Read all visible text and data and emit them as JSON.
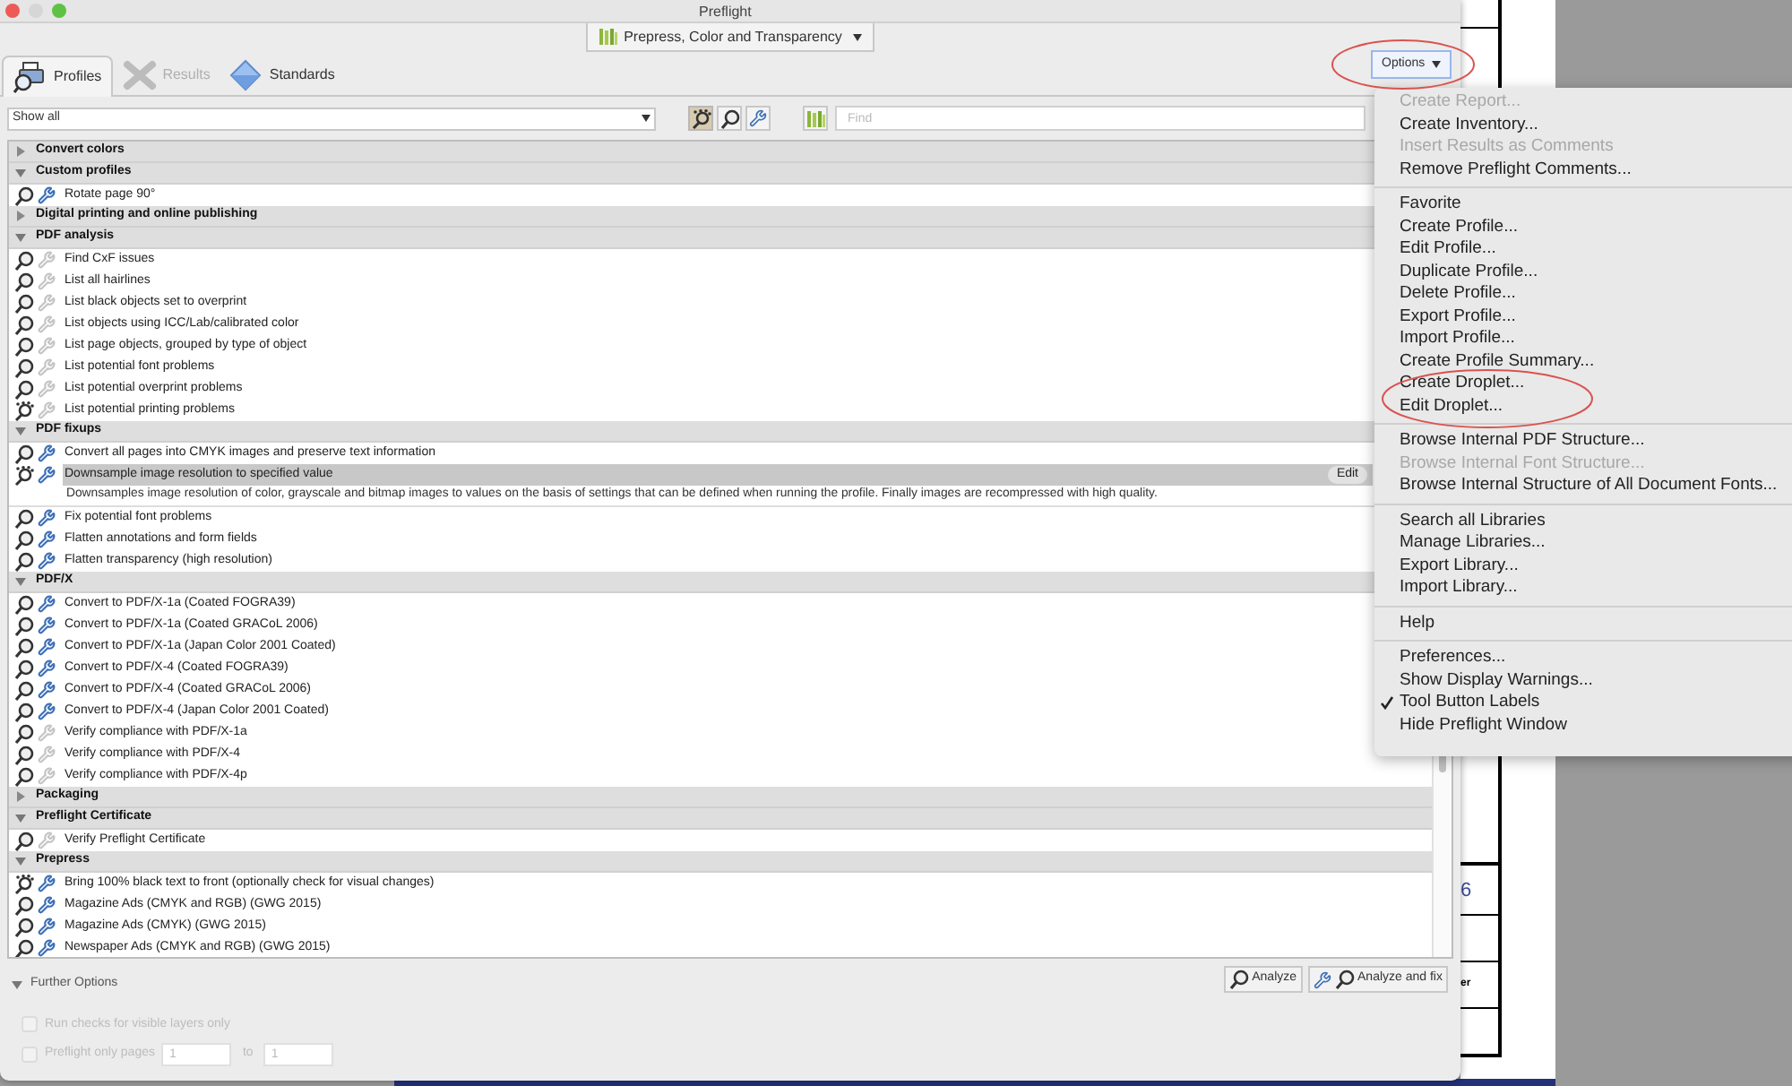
{
  "window": {
    "title": "Preflight"
  },
  "library_dropdown": {
    "value": "Prepress, Color and Transparency"
  },
  "tabs": [
    {
      "label": "Profiles",
      "selected": true,
      "disabled": false,
      "kind": "profiles"
    },
    {
      "label": "Results",
      "selected": false,
      "disabled": true,
      "kind": "results"
    },
    {
      "label": "Standards",
      "selected": false,
      "disabled": false,
      "kind": "standards"
    }
  ],
  "options_button": {
    "label": "Options"
  },
  "filter": {
    "value": "Show all"
  },
  "find": {
    "placeholder": "Find"
  },
  "tree": [
    {
      "kind": "category",
      "label": "Convert colors",
      "expanded": false
    },
    {
      "kind": "category",
      "label": "Custom profiles",
      "expanded": true
    },
    {
      "kind": "profile",
      "label": "Rotate page 90°",
      "droplet": false,
      "fixup": true,
      "selected": false
    },
    {
      "kind": "category",
      "label": "Digital printing and online publishing",
      "expanded": false
    },
    {
      "kind": "category",
      "label": "PDF analysis",
      "expanded": true
    },
    {
      "kind": "profile",
      "label": "Find CxF issues",
      "droplet": false,
      "fixup": false,
      "selected": false
    },
    {
      "kind": "profile",
      "label": "List all hairlines",
      "droplet": false,
      "fixup": false,
      "selected": false
    },
    {
      "kind": "profile",
      "label": "List black objects set to overprint",
      "droplet": false,
      "fixup": false,
      "selected": false
    },
    {
      "kind": "profile",
      "label": "List objects using ICC/Lab/calibrated color",
      "droplet": false,
      "fixup": false,
      "selected": false
    },
    {
      "kind": "profile",
      "label": "List page objects, grouped by type of object",
      "droplet": false,
      "fixup": false,
      "selected": false
    },
    {
      "kind": "profile",
      "label": "List potential font problems",
      "droplet": false,
      "fixup": false,
      "selected": false
    },
    {
      "kind": "profile",
      "label": "List potential overprint problems",
      "droplet": false,
      "fixup": false,
      "selected": false
    },
    {
      "kind": "profile",
      "label": "List potential printing problems",
      "droplet": true,
      "fixup": false,
      "selected": false
    },
    {
      "kind": "category",
      "label": "PDF fixups",
      "expanded": true
    },
    {
      "kind": "profile",
      "label": "Convert all pages into CMYK images and preserve text information",
      "droplet": false,
      "fixup": true,
      "selected": false
    },
    {
      "kind": "profile",
      "label": "Downsample image resolution to specified value",
      "droplet": true,
      "fixup": true,
      "selected": true,
      "edit_label": "Edit",
      "description": "Downsamples image resolution of color, grayscale and bitmap images to values on the basis of settings that can be defined when running the profile. Finally images are recompressed with high quality."
    },
    {
      "kind": "profile",
      "label": "Fix potential font problems",
      "droplet": false,
      "fixup": true,
      "selected": false
    },
    {
      "kind": "profile",
      "label": "Flatten annotations and form fields",
      "droplet": false,
      "fixup": true,
      "selected": false
    },
    {
      "kind": "profile",
      "label": "Flatten transparency (high resolution)",
      "droplet": false,
      "fixup": true,
      "selected": false
    },
    {
      "kind": "category",
      "label": "PDF/X",
      "expanded": true
    },
    {
      "kind": "profile",
      "label": "Convert to PDF/X-1a (Coated FOGRA39)",
      "droplet": false,
      "fixup": true,
      "selected": false
    },
    {
      "kind": "profile",
      "label": "Convert to PDF/X-1a (Coated GRACoL 2006)",
      "droplet": false,
      "fixup": true,
      "selected": false
    },
    {
      "kind": "profile",
      "label": "Convert to PDF/X-1a (Japan Color 2001 Coated)",
      "droplet": false,
      "fixup": true,
      "selected": false
    },
    {
      "kind": "profile",
      "label": "Convert to PDF/X-4 (Coated FOGRA39)",
      "droplet": false,
      "fixup": true,
      "selected": false
    },
    {
      "kind": "profile",
      "label": "Convert to PDF/X-4 (Coated GRACoL 2006)",
      "droplet": false,
      "fixup": true,
      "selected": false
    },
    {
      "kind": "profile",
      "label": "Convert to PDF/X-4 (Japan Color 2001 Coated)",
      "droplet": false,
      "fixup": true,
      "selected": false
    },
    {
      "kind": "profile",
      "label": "Verify compliance with PDF/X-1a",
      "droplet": false,
      "fixup": false,
      "selected": false
    },
    {
      "kind": "profile",
      "label": "Verify compliance with PDF/X-4",
      "droplet": false,
      "fixup": false,
      "selected": false
    },
    {
      "kind": "profile",
      "label": "Verify compliance with PDF/X-4p",
      "droplet": false,
      "fixup": false,
      "selected": false
    },
    {
      "kind": "category",
      "label": "Packaging",
      "expanded": false
    },
    {
      "kind": "category",
      "label": "Preflight Certificate",
      "expanded": true
    },
    {
      "kind": "profile",
      "label": "Verify Preflight Certificate",
      "droplet": false,
      "fixup": false,
      "selected": false
    },
    {
      "kind": "category",
      "label": "Prepress",
      "expanded": true
    },
    {
      "kind": "profile",
      "label": "Bring 100% black text to front (optionally check for visual changes)",
      "droplet": true,
      "fixup": true,
      "selected": false
    },
    {
      "kind": "profile",
      "label": "Magazine Ads (CMYK and RGB) (GWG 2015)",
      "droplet": false,
      "fixup": true,
      "selected": false
    },
    {
      "kind": "profile",
      "label": "Magazine Ads (CMYK) (GWG 2015)",
      "droplet": false,
      "fixup": true,
      "selected": false
    },
    {
      "kind": "profile",
      "label": "Newspaper Ads (CMYK and RGB) (GWG 2015)",
      "droplet": false,
      "fixup": true,
      "selected": false
    }
  ],
  "further_options": {
    "label": "Further Options",
    "expanded": true,
    "visible_layers": {
      "label": "Run checks for visible layers only",
      "checked": false,
      "disabled": true
    },
    "page_range": {
      "label": "Preflight only pages",
      "checked": false,
      "disabled": true,
      "from": "1",
      "to_label": "to",
      "to": "1"
    }
  },
  "buttons": [
    {
      "label": "Analyze",
      "kind": "analyze"
    },
    {
      "label": "Analyze and fix",
      "kind": "fix"
    }
  ],
  "options_menu": [
    [
      {
        "label": "Create Report...",
        "disabled": true,
        "checked": false
      },
      {
        "label": "Create Inventory...",
        "disabled": false,
        "checked": false
      },
      {
        "label": "Insert Results as Comments",
        "disabled": true,
        "checked": false
      },
      {
        "label": "Remove Preflight Comments...",
        "disabled": false,
        "checked": false
      }
    ],
    [
      {
        "label": "Favorite",
        "disabled": false,
        "checked": false
      },
      {
        "label": "Create Profile...",
        "disabled": false,
        "checked": false
      },
      {
        "label": "Edit Profile...",
        "disabled": false,
        "checked": false
      },
      {
        "label": "Duplicate Profile...",
        "disabled": false,
        "checked": false
      },
      {
        "label": "Delete Profile...",
        "disabled": false,
        "checked": false
      },
      {
        "label": "Export Profile...",
        "disabled": false,
        "checked": false
      },
      {
        "label": "Import Profile...",
        "disabled": false,
        "checked": false
      },
      {
        "label": "Create Profile Summary...",
        "disabled": false,
        "checked": false
      },
      {
        "label": "Create Droplet...",
        "disabled": false,
        "checked": false
      },
      {
        "label": "Edit Droplet...",
        "disabled": false,
        "checked": false
      }
    ],
    [
      {
        "label": "Browse Internal PDF Structure...",
        "disabled": false,
        "checked": false
      },
      {
        "label": "Browse Internal Font Structure...",
        "disabled": true,
        "checked": false
      },
      {
        "label": "Browse Internal Structure of All Document Fonts...",
        "disabled": false,
        "checked": false
      }
    ],
    [
      {
        "label": "Search all Libraries",
        "disabled": false,
        "checked": false
      },
      {
        "label": "Manage Libraries...",
        "disabled": false,
        "checked": false
      },
      {
        "label": "Export Library...",
        "disabled": false,
        "checked": false
      },
      {
        "label": "Import Library...",
        "disabled": false,
        "checked": false
      }
    ],
    [
      {
        "label": "Help",
        "disabled": false,
        "checked": false
      }
    ],
    [
      {
        "label": "Preferences...",
        "disabled": false,
        "checked": false
      },
      {
        "label": "Show Display Warnings...",
        "disabled": false,
        "checked": false
      },
      {
        "label": "Tool Button Labels",
        "disabled": false,
        "checked": true
      },
      {
        "label": "Hide Preflight Window",
        "disabled": false,
        "checked": false
      }
    ]
  ],
  "document_fragments": [
    "6",
    "er"
  ]
}
